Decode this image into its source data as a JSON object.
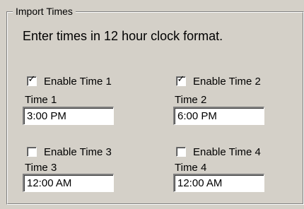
{
  "group": {
    "title": "Import Times"
  },
  "instructions": "Enter times in 12 hour clock format.",
  "times": [
    {
      "enable_label": "Enable Time 1",
      "checked": true,
      "label": "Time 1",
      "value": "3:00 PM"
    },
    {
      "enable_label": "Enable Time 2",
      "checked": true,
      "label": "Time 2",
      "value": "6:00 PM"
    },
    {
      "enable_label": "Enable Time 3",
      "checked": false,
      "label": "Time 3",
      "value": "12:00 AM"
    },
    {
      "enable_label": "Enable Time 4",
      "checked": false,
      "label": "Time 4",
      "value": "12:00 AM"
    }
  ],
  "colors": {
    "face": "#d4d0c8",
    "shadow": "#808080",
    "highlight": "#ffffff"
  }
}
